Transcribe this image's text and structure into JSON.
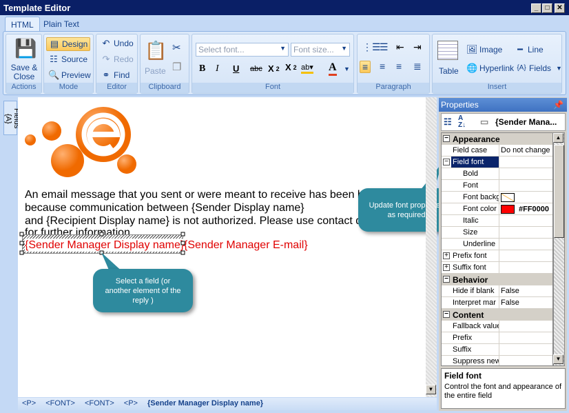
{
  "window": {
    "title": "Template Editor",
    "minimize": "_",
    "maximize": "□",
    "close": "✕"
  },
  "tabs": [
    {
      "label": "HTML",
      "active": true
    },
    {
      "label": "Plain Text",
      "active": false
    }
  ],
  "ribbon": {
    "actions": {
      "label": "Actions",
      "save_close": "Save & Close"
    },
    "mode": {
      "label": "Mode",
      "design": "Design",
      "source": "Source",
      "preview": "Preview",
      "selected": "Design"
    },
    "editor": {
      "label": "Editor",
      "undo": "Undo",
      "redo": "Redo",
      "find": "Find"
    },
    "clipboard": {
      "label": "Clipboard",
      "paste": "Paste"
    },
    "font": {
      "label": "Font",
      "font_placeholder": "Select font...",
      "size_placeholder": "Font size..."
    },
    "paragraph": {
      "label": "Paragraph"
    },
    "insert": {
      "label": "Insert",
      "table": "Table",
      "image": "Image",
      "line": "Line",
      "hyperlink": "Hyperlink",
      "fields": "Fields"
    }
  },
  "sidebar": {
    "fields_tab": "Fields"
  },
  "document": {
    "lines": [
      "An email message that you sent or were meant to receive has been blo",
      "because communication between {Sender Display name}",
      "and {Recipient Display name} is not authorized. Please use contact det",
      "for further information."
    ],
    "selected_field": "{Sender Manager Display name}",
    "next_field": "{Sender Manager E-mail}",
    "field_color": "#e00000"
  },
  "callouts": {
    "select": "Select a field (or another element of the reply )",
    "update": "Update font properties as required"
  },
  "statusbar": {
    "tags": [
      "<P>",
      "<FONT>",
      "<FONT>",
      "<P>"
    ],
    "current": "{Sender Manager Display name}"
  },
  "properties": {
    "title": "Properties",
    "object": "{Sender Mana...",
    "rows": [
      {
        "type": "cat",
        "name": "Appearance",
        "expanded": true
      },
      {
        "name": "Field case",
        "value": "Do not change"
      },
      {
        "name": "Field font",
        "expandable": true,
        "expanded": true,
        "selected": true
      },
      {
        "name": "Bold",
        "indent": true
      },
      {
        "name": "Font",
        "indent": true
      },
      {
        "name": "Font backg",
        "indent": true,
        "swatch": "none"
      },
      {
        "name": "Font color",
        "indent": true,
        "swatch": "#FF0000",
        "value": "#FF0000"
      },
      {
        "name": "Italic",
        "indent": true
      },
      {
        "name": "Size",
        "indent": true
      },
      {
        "name": "Underline",
        "indent": true
      },
      {
        "name": "Prefix font",
        "expandable": true,
        "expanded": false
      },
      {
        "name": "Suffix font",
        "expandable": true,
        "expanded": false
      },
      {
        "type": "cat",
        "name": "Behavior",
        "expanded": true
      },
      {
        "name": "Hide if blank",
        "value": "False"
      },
      {
        "name": "Interpret mar",
        "value": "False"
      },
      {
        "type": "cat",
        "name": "Content",
        "expanded": true
      },
      {
        "name": "Fallback value"
      },
      {
        "name": "Prefix"
      },
      {
        "name": "Suffix"
      },
      {
        "name": "Suppress new"
      }
    ],
    "description": {
      "title": "Field font",
      "text": "Control the font and appearance of the entire field"
    }
  }
}
